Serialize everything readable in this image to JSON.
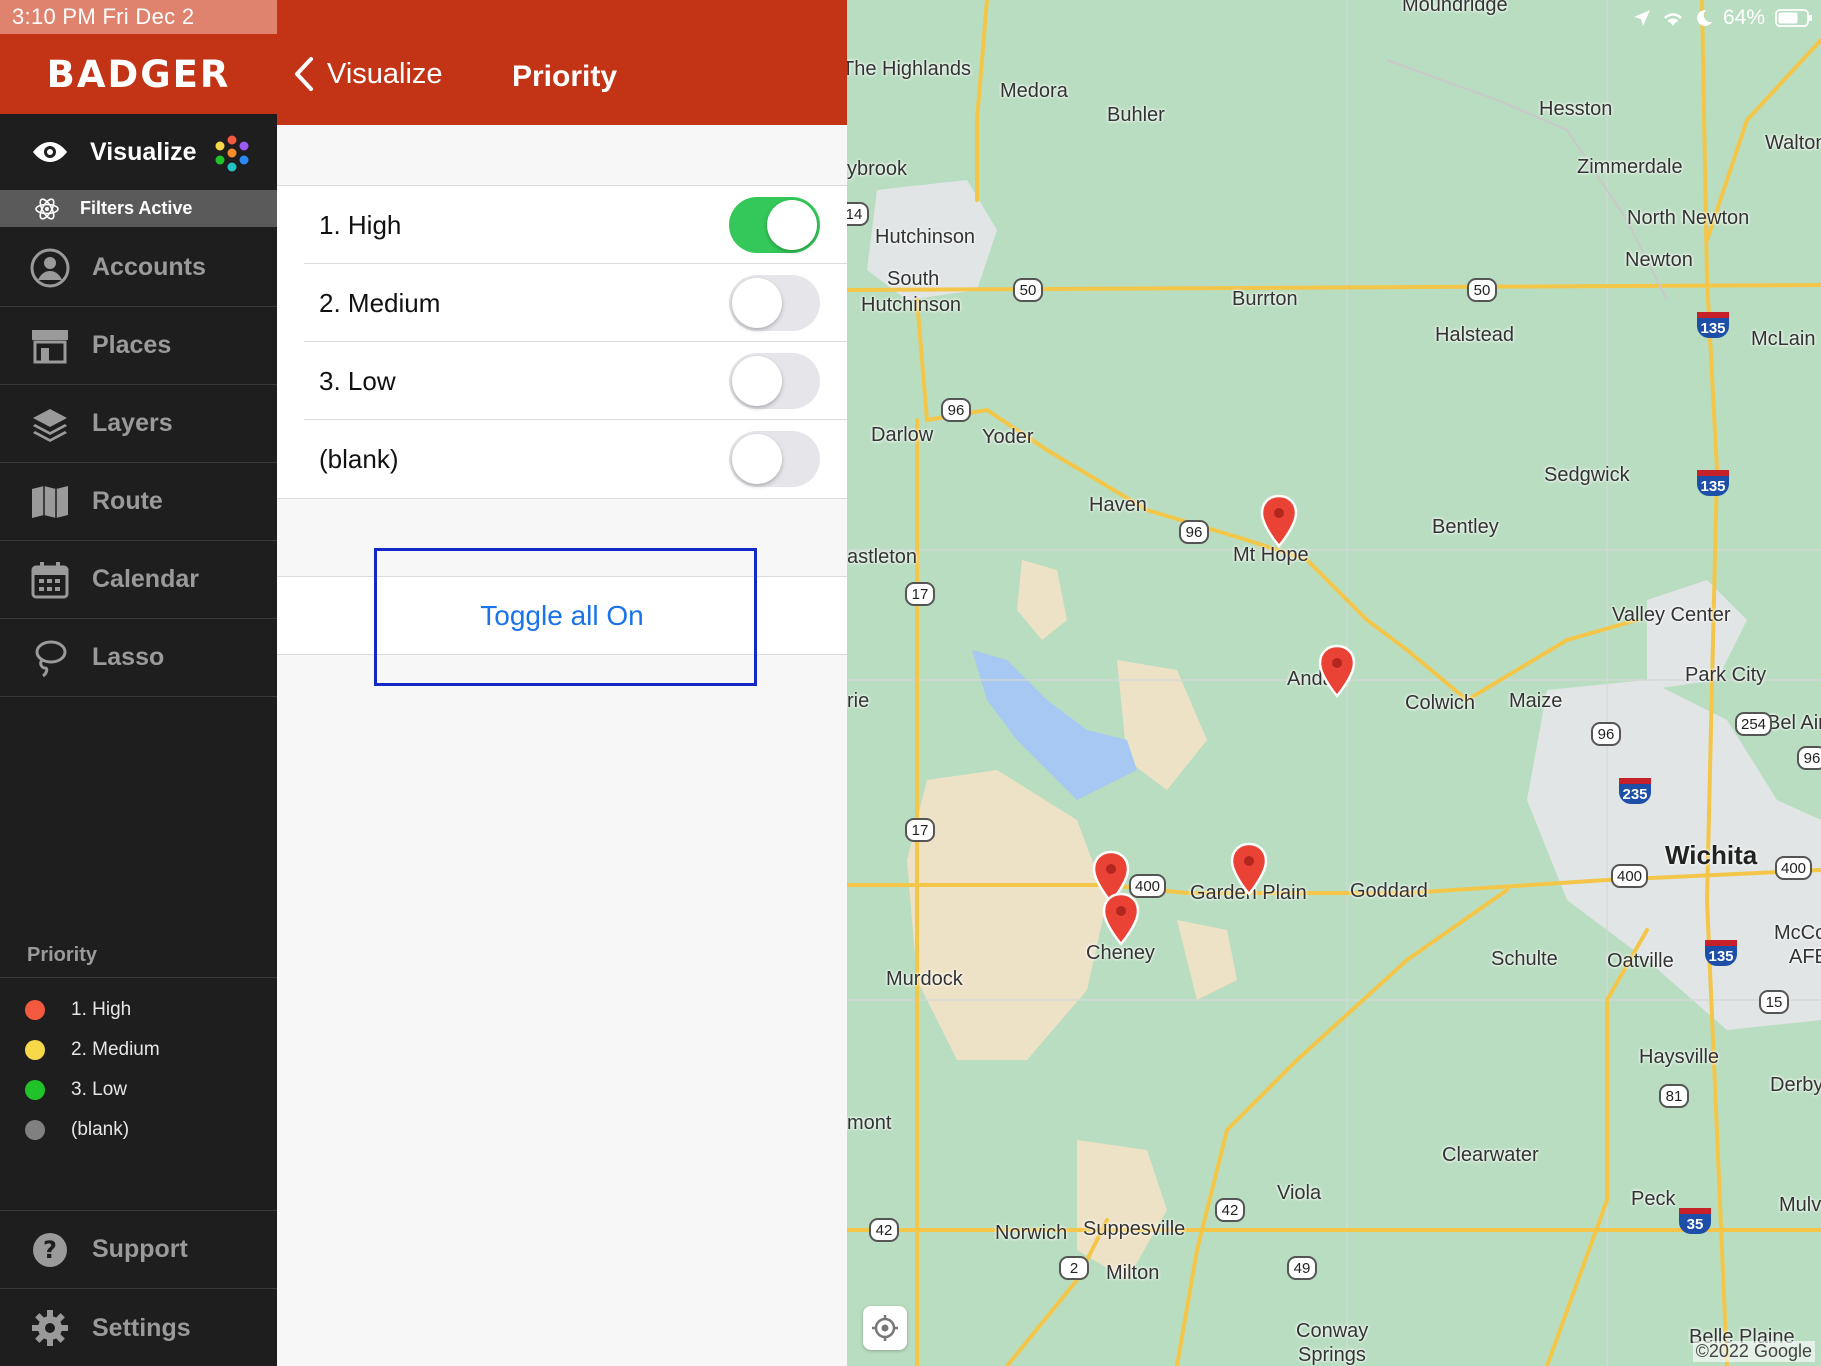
{
  "status": {
    "time_date": "3:10 PM   Fri Dec 2",
    "battery": "64%"
  },
  "brand": {
    "name": "BADGER"
  },
  "nav": {
    "active": {
      "label": "Visualize",
      "icon": "eye-icon"
    },
    "filters_label": "Filters Active",
    "items": [
      {
        "id": "accounts",
        "label": "Accounts",
        "icon": "account-icon"
      },
      {
        "id": "places",
        "label": "Places",
        "icon": "store-icon"
      },
      {
        "id": "layers",
        "label": "Layers",
        "icon": "layers-icon"
      },
      {
        "id": "route",
        "label": "Route",
        "icon": "map-icon"
      },
      {
        "id": "calendar",
        "label": "Calendar",
        "icon": "calendar-icon"
      },
      {
        "id": "lasso",
        "label": "Lasso",
        "icon": "lasso-icon"
      }
    ],
    "bottom": [
      {
        "id": "support",
        "label": "Support",
        "icon": "help-icon"
      },
      {
        "id": "settings",
        "label": "Settings",
        "icon": "gear-icon"
      }
    ]
  },
  "legend": {
    "title": "Priority",
    "items": [
      {
        "label": "1. High",
        "color": "#f2593f"
      },
      {
        "label": "2. Medium",
        "color": "#f7d84a"
      },
      {
        "label": "3. Low",
        "color": "#21c32b"
      },
      {
        "label": "(blank)",
        "color": "#808080"
      }
    ]
  },
  "panel": {
    "back_label": "Visualize",
    "title": "Priority",
    "toggles": [
      {
        "label": "1. High",
        "on": true
      },
      {
        "label": "2. Medium",
        "on": false
      },
      {
        "label": "3. Low",
        "on": false
      },
      {
        "label": "(blank)",
        "on": false
      }
    ],
    "toggle_all_label": "Toggle all On"
  },
  "map": {
    "copyright": "©2022 Google",
    "places": [
      "Moundridge",
      "The Highlands",
      "Medora",
      "Buhler",
      "Hesston",
      "Walton",
      "Zimmerdale",
      "ybrook",
      "North Newton",
      "Newton",
      "Hutchinson",
      "South",
      "Hutchinson",
      "Burrton",
      "Halstead",
      "McLain",
      "Darlow",
      "Yoder",
      "Sedgwick",
      "Haven",
      "Mt Hope",
      "Bentley",
      "astleton",
      "Valley Center",
      "Andale",
      "Colwich",
      "Maize",
      "Park City",
      "Bel Aire",
      "rie",
      "Wichita",
      "Garden Plain",
      "Goddard",
      "Cheney",
      "Murdock",
      "Schulte",
      "Oatville",
      "McCon",
      "AFB",
      "Haysville",
      "Derby",
      "mont",
      "Clearwater",
      "Viola",
      "Peck",
      "Mulv",
      "Norwich",
      "Suppesville",
      "Milton",
      "Conway",
      "Springs",
      "Belle Plaine"
    ],
    "shields": [
      "50",
      "50",
      "96",
      "96",
      "17",
      "17",
      "400",
      "400",
      "400",
      "254",
      "96",
      "96",
      "42",
      "42",
      "2",
      "49",
      "15",
      "81",
      "14"
    ],
    "interstates": [
      "135",
      "135",
      "235",
      "135",
      "35"
    ]
  }
}
